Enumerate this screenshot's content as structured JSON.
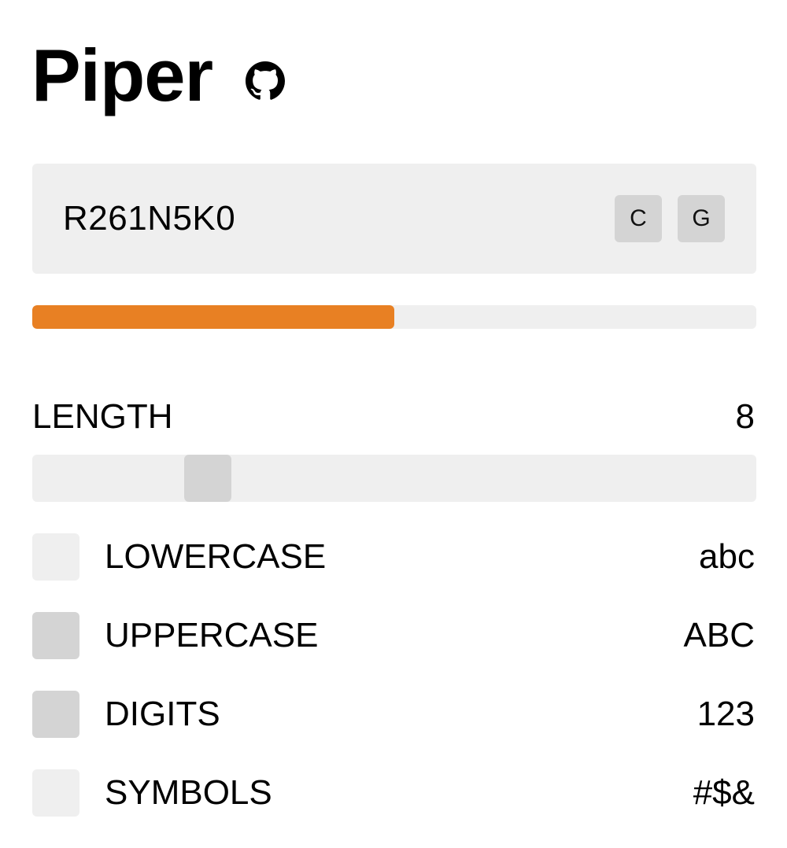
{
  "app": {
    "title": "Piper",
    "github_icon": "github-icon"
  },
  "password": {
    "value": "R261N5K0",
    "copy_label": "C",
    "generate_label": "G"
  },
  "strength": {
    "fraction": 0.5,
    "color": "#e88023"
  },
  "length": {
    "label": "LENGTH",
    "value": "8",
    "slider_fraction": 0.21
  },
  "options": [
    {
      "label": "LOWERCASE",
      "sample": "abc",
      "checked": false
    },
    {
      "label": "UPPERCASE",
      "sample": "ABC",
      "checked": true
    },
    {
      "label": "DIGITS",
      "sample": "123",
      "checked": true
    },
    {
      "label": "SYMBOLS",
      "sample": "#$&",
      "checked": false
    }
  ],
  "colors": {
    "panel": "#efefef",
    "control": "#d4d4d4",
    "accent": "#e88023"
  }
}
